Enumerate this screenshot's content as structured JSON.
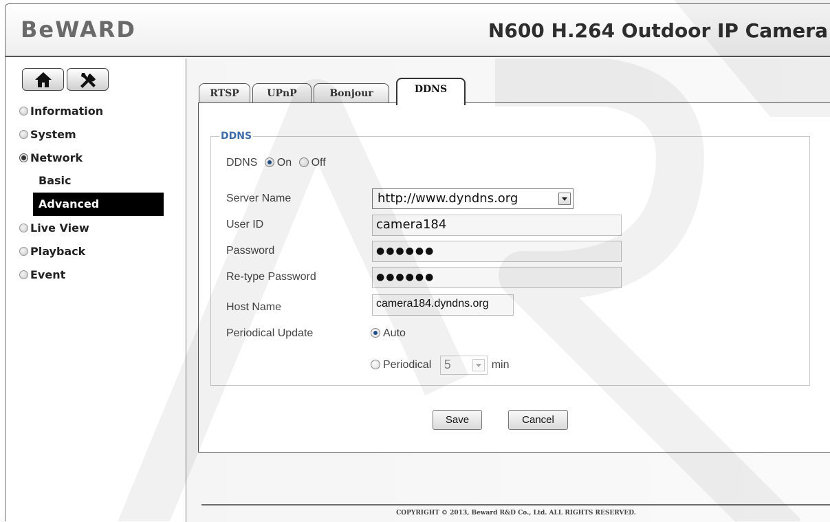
{
  "header": {
    "logo": "BeWARD",
    "title": "N600 H.264 Outdoor IP Camera"
  },
  "toolbar": {
    "home_icon": "home-icon",
    "settings_icon": "tools-icon"
  },
  "sidebar": {
    "items": [
      {
        "label": "Information"
      },
      {
        "label": "System"
      },
      {
        "label": "Network"
      },
      {
        "label": "Live View"
      },
      {
        "label": "Playback"
      },
      {
        "label": "Event"
      }
    ],
    "network_sub": [
      {
        "label": "Basic"
      },
      {
        "label": "Advanced"
      }
    ]
  },
  "tabs": [
    {
      "label": "RTSP"
    },
    {
      "label": "UPnP"
    },
    {
      "label": "Bonjour"
    },
    {
      "label": "DDNS"
    }
  ],
  "form": {
    "legend": "DDNS",
    "ddns_label": "DDNS",
    "on_label": "On",
    "off_label": "Off",
    "server_name_label": "Server Name",
    "server_name_value": "http://www.dyndns.org",
    "user_id_label": "User ID",
    "user_id_value": "camera184",
    "password_label": "Password",
    "password_value": "●●●●●●",
    "retype_label": "Re-type Password",
    "retype_value": "●●●●●●",
    "host_label": "Host Name",
    "host_value": "camera184.dyndns.org",
    "periodical_label": "Periodical Update",
    "auto_label": "Auto",
    "periodical_opt_label": "Periodical",
    "interval_value": "5",
    "interval_unit": "min"
  },
  "buttons": {
    "save": "Save",
    "cancel": "Cancel"
  },
  "footer": {
    "copyright": "COPYRIGHT © 2013, Beward R&D Co., Ltd. ALL RIGHTS RESERVED."
  },
  "colors": {
    "legend_blue": "#3d6aa8",
    "active_nav_bg": "#000000"
  }
}
